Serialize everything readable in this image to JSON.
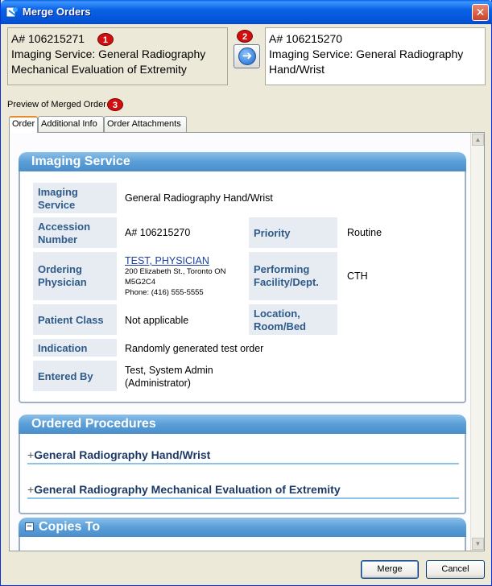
{
  "window": {
    "title": "Merge Orders",
    "close_label": "✕"
  },
  "left_order": {
    "accession": "A#  106215271",
    "badge": "1",
    "line1": "Imaging Service: General Radiography",
    "line2": "Mechanical Evaluation of Extremity"
  },
  "arrow_badge": "2",
  "right_order": {
    "accession": "A#  106215270",
    "line1": "Imaging Service: General Radiography",
    "line2": "Hand/Wrist"
  },
  "preview": {
    "label": "Preview of Merged Order",
    "badge": "3"
  },
  "tabs": [
    {
      "label": "Order"
    },
    {
      "label": "Additional Info"
    },
    {
      "label": "Order Attachments"
    }
  ],
  "imaging_service": {
    "header": "Imaging Service",
    "labels": {
      "imaging_service": "Imaging Service",
      "accession": "Accession Number",
      "priority": "Priority",
      "ordering": "Ordering Physician",
      "performing": "Performing Facility/Dept.",
      "patient_class": "Patient Class",
      "location": "Location, Room/Bed",
      "indication": "Indication",
      "entered_by": "Entered By"
    },
    "values": {
      "imaging_service": "General Radiography Hand/Wrist",
      "accession": "A# 106215270",
      "priority": "Routine",
      "physician_name": "TEST, PHYSICIAN",
      "physician_address": "200 Elizabeth St., Toronto ON",
      "physician_postal": "M5G2C4",
      "physician_phone": "Phone: (416) 555-5555",
      "performing": "CTH",
      "patient_class": "Not applicable",
      "location": "",
      "indication": "Randomly generated test order",
      "entered_by_line1": "Test, System Admin",
      "entered_by_line2": "(Administrator)"
    }
  },
  "ordered_procedures": {
    "header": "Ordered Procedures",
    "items": [
      {
        "label": "General Radiography Hand/Wrist"
      },
      {
        "label": "General Radiography Mechanical Evaluation of Extremity"
      }
    ]
  },
  "copies_to": {
    "header": "Copies To",
    "toggle": "−"
  },
  "buttons": {
    "merge": "Merge",
    "cancel": "Cancel"
  },
  "colors": {
    "accent": "#5a9fd8",
    "badge": "#d01010",
    "label_text": "#2f5b8a"
  }
}
